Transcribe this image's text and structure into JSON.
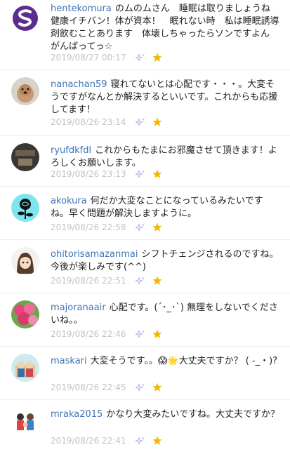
{
  "comments": [
    {
      "user": "hentekomura",
      "text": "のムのムさん　睡眠は取りましょうね　健康イチバン！体が資本！　眠れない時　私は睡眠誘導剤飲むことあります　体壊しちゃったらソンですよん　がんばってっ☆",
      "time": "2019/08/27 00:17",
      "avatar": "purple-s-logo"
    },
    {
      "user": "nanachan59",
      "text": "寝れてないとは心配です・・・。大変そうですがなんとか解決するといいです。これからも応援してます！",
      "time": "2019/08/26 23:14",
      "avatar": "dog-photo"
    },
    {
      "user": "ryufdkfdl",
      "text": "これからもたまにお邪魔させて頂きます！よろしくお願いします。",
      "time": "2019/08/26 23:13",
      "avatar": "dark-photo"
    },
    {
      "user": "akokura",
      "text": "何だか大変なことになっているみたいですね。早く問題が解決しますように。",
      "time": "2019/08/26 22:58",
      "avatar": "black-rose-icon"
    },
    {
      "user": "ohitorisamazanmai",
      "text": "シフトチェンジされるのですね。今後が楽しみです(^^)",
      "time": "2019/08/26 22:51",
      "avatar": "anime-girl"
    },
    {
      "user": "majoranaair",
      "text": "心配です。(´･_･`) 無理をしないでくださいね。。",
      "time": "2019/08/26 22:46",
      "avatar": "pink-flowers"
    },
    {
      "user": "maskari",
      "text": "大変そうです。。😱🌟大丈夫ですか？ ( -_・)?",
      "time": "2019/08/26 22:45",
      "avatar": "cartoon-figures"
    },
    {
      "user": "mraka2015",
      "text": "かなり大変みたいですね。大丈夫ですか？",
      "time": "2019/08/26 22:41",
      "avatar": "family-illustration"
    }
  ],
  "colors": {
    "username": "#3e74b5",
    "star": "#f5b800",
    "timestamp": "#c3c3c3",
    "accent": "#5b2d8e"
  }
}
